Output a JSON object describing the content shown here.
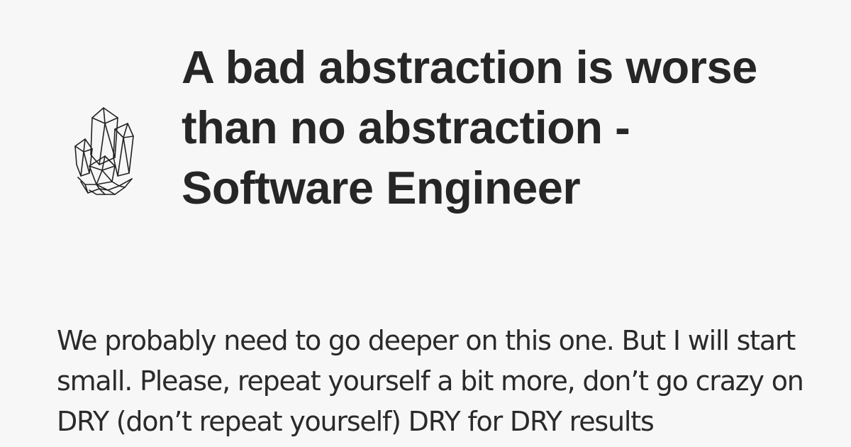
{
  "header": {
    "logo_icon": "crystal-cluster-icon",
    "title": "A bad abstraction is worse than no abstraction - Software Engineer"
  },
  "excerpt": {
    "text": "We probably need to go deeper on this one. But I will start small. Please, repeat yourself a bit more, don’t go crazy on DRY (don’t repeat yourself) DRY for DRY results"
  },
  "colors": {
    "background": "#f8f7f8",
    "text": "#262626"
  }
}
